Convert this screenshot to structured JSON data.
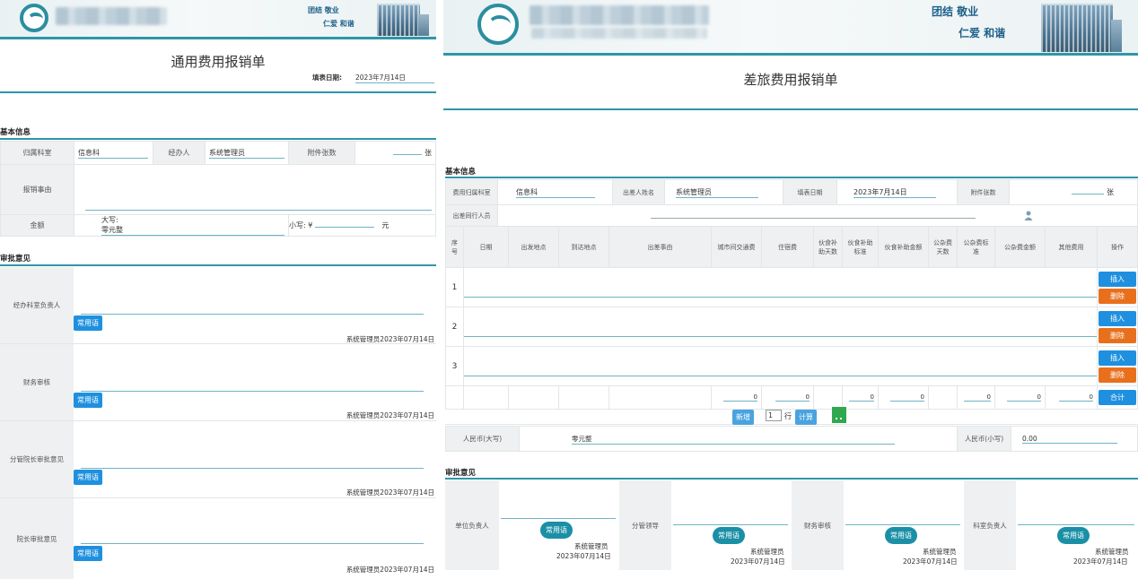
{
  "left": {
    "banner": {
      "slogan_line1": "团结  敬业",
      "slogan_line2": "仁爱  和谐"
    },
    "title": "通用费用报销单",
    "fill_date_label": "填表日期:",
    "fill_date_value": "2023年7月14日",
    "basic_info_title": "基本信息",
    "dept_label": "归属科室",
    "dept_value": "信息科",
    "handler_label": "经办人",
    "handler_value": "系统管理员",
    "attach_label": "附件张数",
    "attach_unit": "张",
    "reason_label": "报销事由",
    "amount_label": "金额",
    "amount_upper_label": "大写:",
    "amount_upper_value": "零元整",
    "amount_lower_label": "小写: ¥",
    "amount_lower_unit": "元",
    "approval_title": "审批意见",
    "approvals": [
      {
        "label": "经办科室负责人",
        "button": "常用语",
        "signer": "系统管理员2023年07月14日"
      },
      {
        "label": "财务审核",
        "button": "常用语",
        "signer": "系统管理员2023年07月14日"
      },
      {
        "label": "分管院长审批意见",
        "button": "常用语",
        "signer": "系统管理员2023年07月14日"
      },
      {
        "label": "院长审批意见",
        "button": "常用语",
        "signer": "系统管理员2023年07月14日"
      }
    ]
  },
  "right": {
    "banner": {
      "slogan_line1": "团结  敬业",
      "slogan_line2": "仁爱  和谐"
    },
    "title": "差旅费用报销单",
    "basic_info_title": "基本信息",
    "dept_label": "费用归属科室",
    "dept_value": "信息科",
    "traveler_label": "出差人姓名",
    "traveler_value": "系统管理员",
    "date_label": "填表日期",
    "date_value": "2023年7月14日",
    "attach_label": "附件张数",
    "attach_unit": "张",
    "companions_label": "出差同行人员",
    "columns": [
      "序号",
      "日期",
      "出发地点",
      "到达地点",
      "出差事由",
      "城市间交通费",
      "住宿费",
      "伙食补助天数",
      "伙食补助标准",
      "伙食补助金额",
      "公杂费天数",
      "公杂费标准",
      "公杂费金额",
      "其他费用",
      "操作"
    ],
    "rows": [
      {
        "index": "1",
        "insert": "插入",
        "delete": "删除"
      },
      {
        "index": "2",
        "insert": "插入",
        "delete": "删除"
      },
      {
        "index": "3",
        "insert": "插入",
        "delete": "删除"
      }
    ],
    "totals": [
      "0",
      "0",
      "0",
      "0",
      "0",
      "0",
      "0"
    ],
    "total_button": "合计",
    "add_button": "新增",
    "add_count": "1",
    "row_unit": "行",
    "calc_button": "计算",
    "rmb_upper_label": "人民币(大写)",
    "rmb_upper_value": "零元整",
    "rmb_lower_label": "人民币(小写)",
    "rmb_lower_value": "0.00",
    "approval_title": "审批意见",
    "approvals": [
      {
        "label": "单位负责人",
        "button": "常用语",
        "signer_name": "系统管理员",
        "signer_date": "2023年07月14日"
      },
      {
        "label": "分管领导",
        "button": "常用语",
        "signer_name": "系统管理员",
        "signer_date": "2023年07月14日"
      },
      {
        "label": "财务审核",
        "button": "常用语",
        "signer_name": "系统管理员",
        "signer_date": "2023年07月14日"
      },
      {
        "label": "科室负责人",
        "button": "常用语",
        "signer_name": "系统管理员",
        "signer_date": "2023年07月14日"
      }
    ]
  },
  "colors": {
    "accent": "#2e96a8",
    "button_blue": "#1f90df",
    "button_orange": "#e8701c"
  }
}
